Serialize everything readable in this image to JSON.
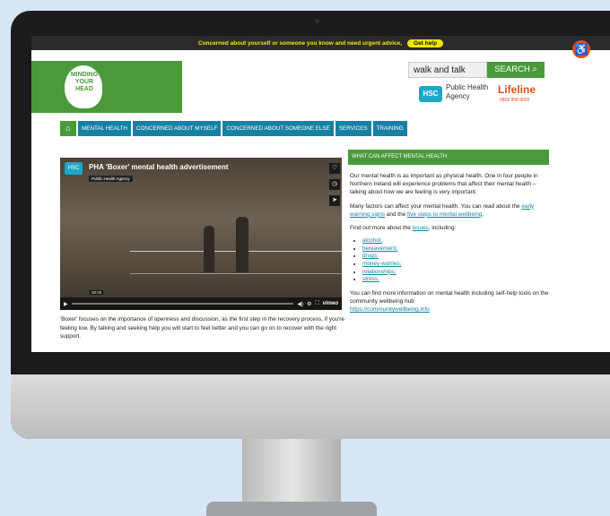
{
  "alert": {
    "text": "Concerned about yourself or someone you know and need urgent advice,",
    "button": "Get help"
  },
  "header": {
    "logo_text": "MINDING YOUR HEAD",
    "search_value": "walk and talk",
    "search_button": "SEARCH",
    "hsc_label": "HSC",
    "pha_label": "Public Health Agency",
    "lifeline_label": "Lifeline",
    "lifeline_number": "0808 808 8000"
  },
  "nav": [
    "MENTAL HEALTH",
    "CONCERNED ABOUT MYSELF",
    "CONCERNED ABOUT SOMEONE ELSE",
    "SERVICES",
    "TRAINING"
  ],
  "video": {
    "badge": "HSC",
    "title": "PHA 'Boxer' mental health advertisement",
    "subtitle": "Public Health Agency",
    "time": "00:00",
    "brand": "vimeo"
  },
  "caption": "'Boxer' focuses on the importance of openness and discussion, as the first step in the recovery process, if you're feeling low. By talking and seeking help you will start to feel better and you can go on to recover with the right support.",
  "sidebar": {
    "heading": "WHAT CAN AFFECT MENTAL HEALTH",
    "p1": "Our mental health is as important as physical health. One in four people in Northern Ireland will experience problems that affect their mental health – talking about how we are feeling is very important.",
    "p2_a": "Many factors can affect your mental health. You can read about the ",
    "p2_link1": "early warning signs",
    "p2_b": " and the ",
    "p2_link2": "five steps to mental wellbeing",
    "p2_c": ".",
    "p3_a": "Find out more about the ",
    "p3_link": "issues",
    "p3_b": ", including:",
    "issues": [
      "alcohol;",
      "bereavement;",
      "drugs;",
      "money worries;",
      "relationships;",
      "stress."
    ],
    "p4": "You can find more information on mental health including self-help tools on the community wellbeing hub",
    "p4_link": "https://communitywellbeing.info"
  }
}
